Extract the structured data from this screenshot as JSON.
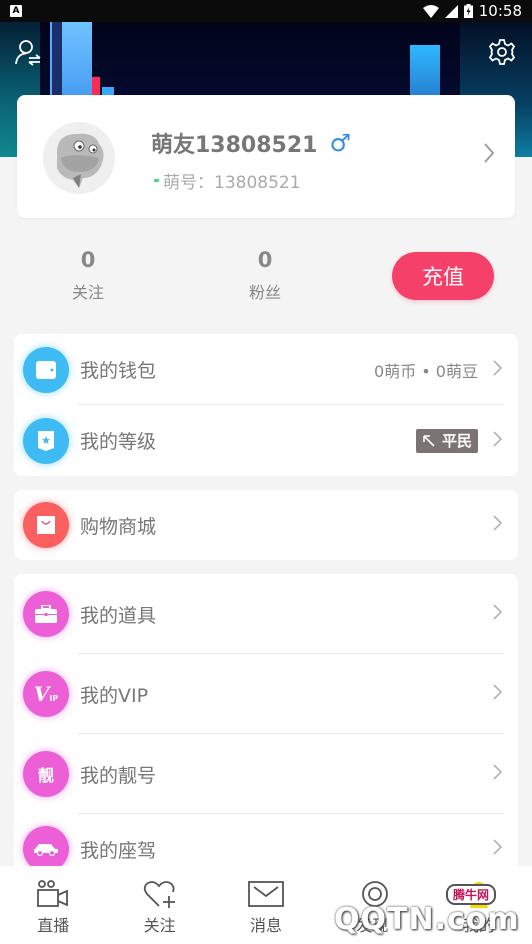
{
  "status_bar": {
    "notification_glyph": "A",
    "time": "10:58",
    "icons": [
      "wifi-icon",
      "cellular-signal-icon",
      "battery-charging-icon"
    ]
  },
  "header": {
    "left_icon": "switch-account-icon",
    "right_icon": "gear-icon"
  },
  "profile": {
    "nickname": "萌友13808521",
    "gender_symbol": "♂",
    "id_label": "萌号：13808521"
  },
  "stats": {
    "follow": {
      "count": "0",
      "label": "关注"
    },
    "fans": {
      "count": "0",
      "label": "粉丝"
    },
    "recharge_label": "充值"
  },
  "menu_groups": [
    {
      "items": [
        {
          "label": "我的钱包",
          "icon": "wallet-icon",
          "detail": "0萌币 • 0萌豆"
        },
        {
          "label": "我的等级",
          "icon": "level-badge-icon",
          "badge_text": "平民",
          "badge_icon": "pickaxe-icon"
        }
      ]
    },
    {
      "items": [
        {
          "label": "购物商城",
          "icon": "shopping-bag-icon"
        }
      ]
    },
    {
      "items": [
        {
          "label": "我的道具",
          "icon": "toolbox-icon"
        },
        {
          "label": "我的VIP",
          "icon": "vip-icon",
          "icon_text": "V",
          "icon_subtext": "IP"
        },
        {
          "label": "我的靓号",
          "icon": "pretty-number-icon",
          "icon_text": "靓"
        },
        {
          "label": "我的座驾",
          "icon": "car-icon"
        }
      ]
    }
  ],
  "colors": {
    "accent": "#f5406a",
    "blue_icon": "#3ebbf2",
    "red_icon": "#fb5f5f",
    "pink_icon": "#ec5fd6",
    "gender": "#2f8fe8",
    "online": "#3ddc84"
  },
  "bottom_nav": [
    {
      "label": "直播",
      "icon": "video-camera-icon"
    },
    {
      "label": "关注",
      "icon": "heart-plus-icon"
    },
    {
      "label": "消息",
      "icon": "envelope-icon"
    },
    {
      "label": "发现",
      "icon": "discover-icon"
    },
    {
      "label": "我的",
      "icon": "profile-icon"
    }
  ],
  "watermark": {
    "text": "腾牛网",
    "domain": "QQTN.com"
  }
}
